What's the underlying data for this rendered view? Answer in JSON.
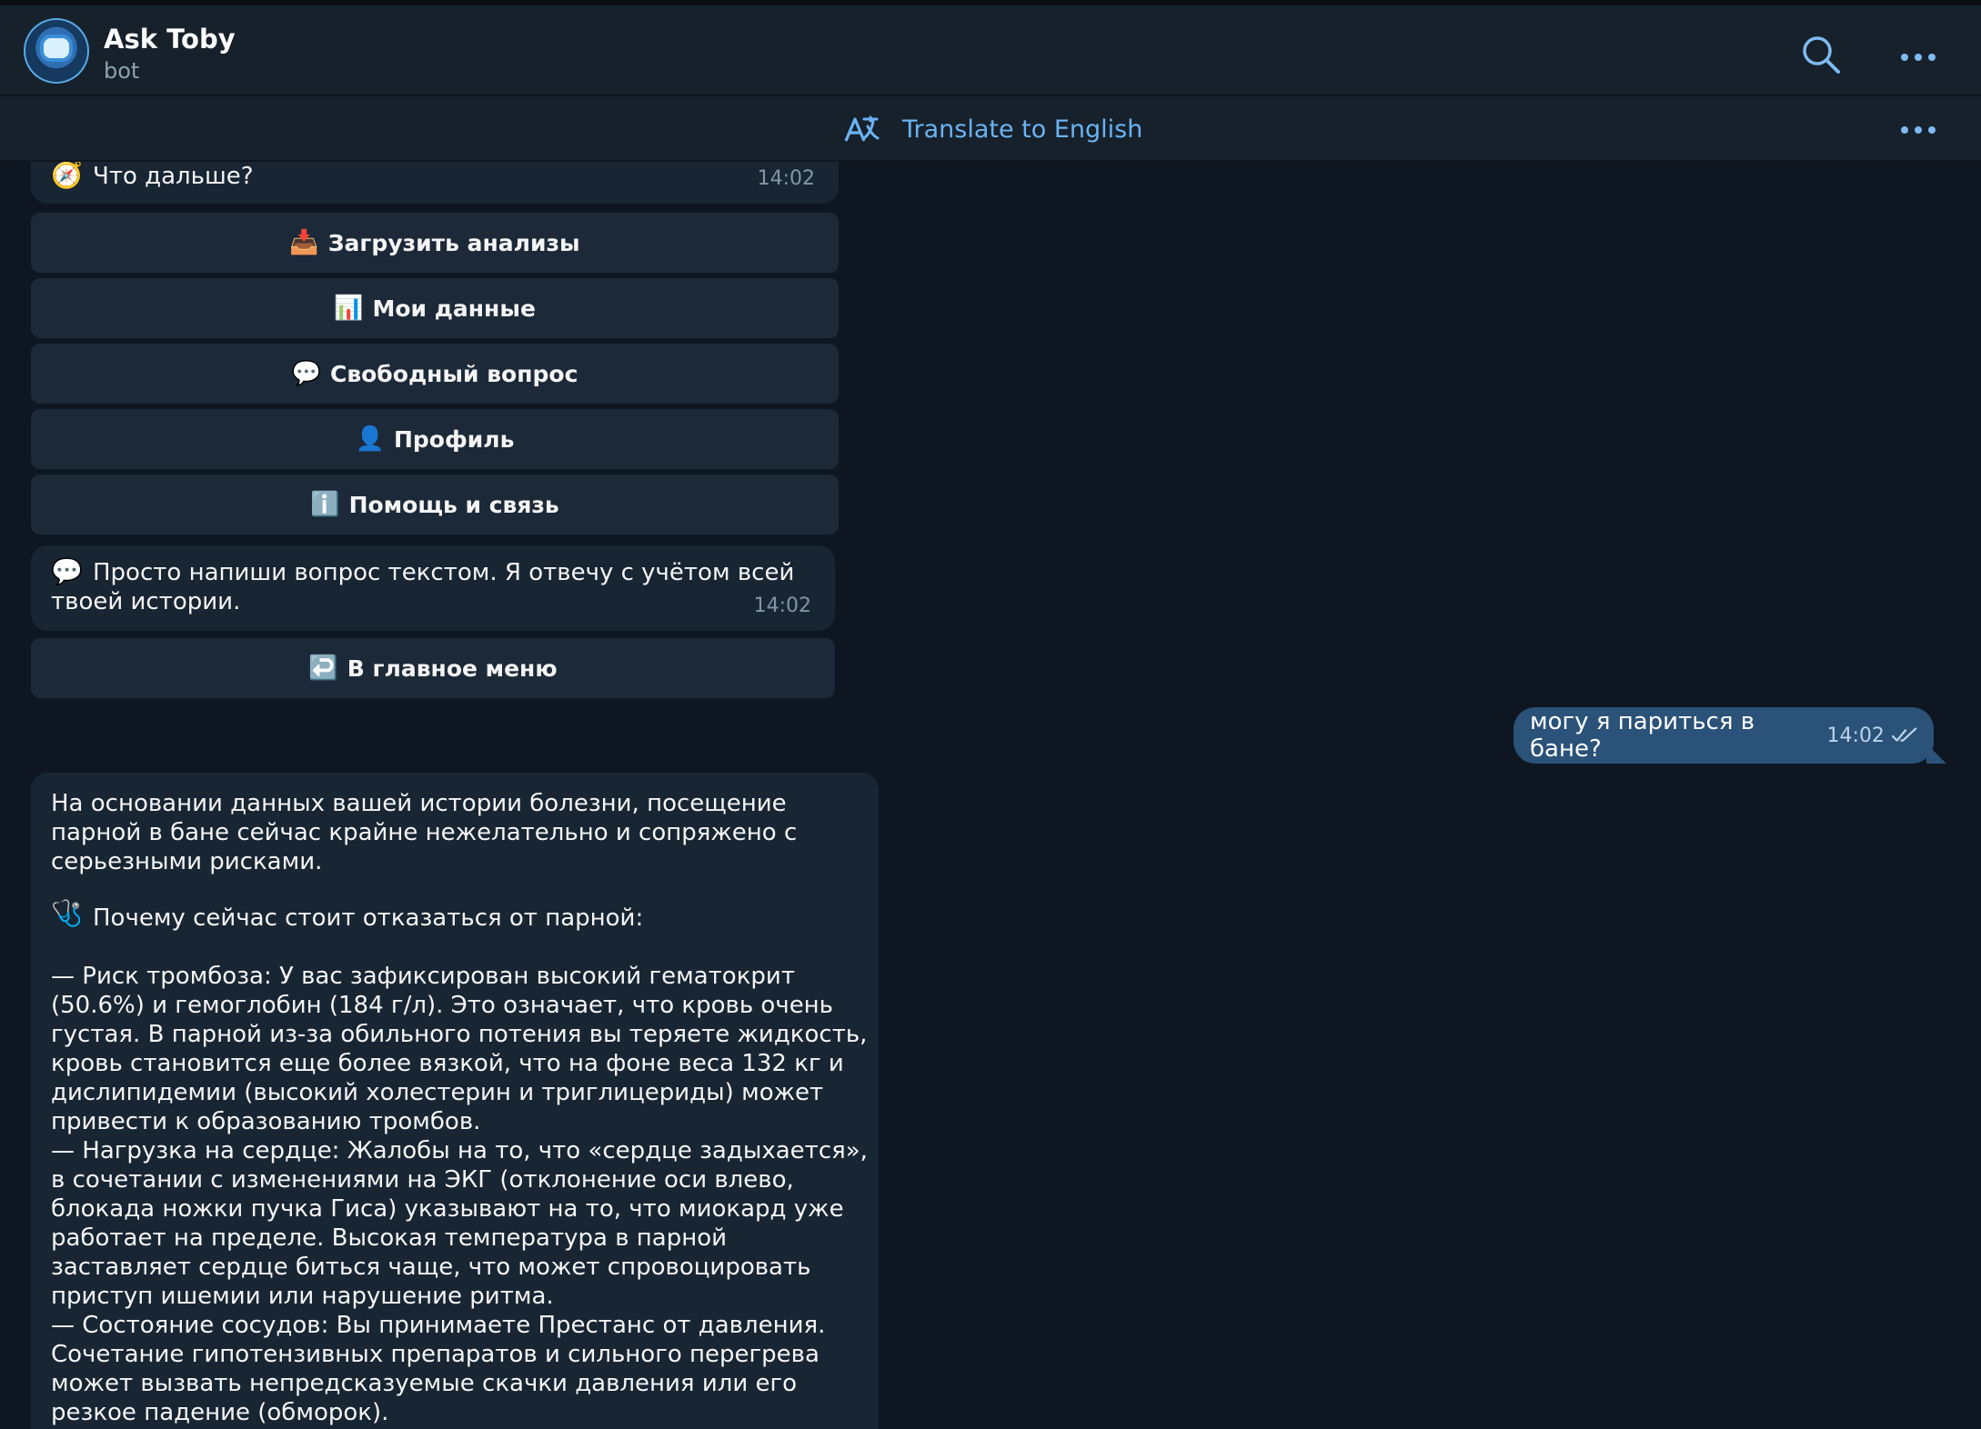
{
  "header": {
    "title": "Ask Toby",
    "subtitle": "bot"
  },
  "translate": {
    "label": "Translate to English"
  },
  "messages": {
    "next": {
      "text": "Что дальше?",
      "time": "14:02",
      "icon": "compass-icon"
    },
    "buttons": [
      {
        "label": "Загрузить анализы",
        "icon": "upload-icon"
      },
      {
        "label": "Мои данные",
        "icon": "chart-icon"
      },
      {
        "label": "Свободный вопрос",
        "icon": "speech-bubble-icon"
      },
      {
        "label": "Профиль",
        "icon": "profile-icon"
      },
      {
        "label": "Помощь и связь",
        "icon": "info-icon"
      }
    ],
    "prompt": {
      "text": "Просто напиши вопрос текстом. Я отвечу с учётом всей твоей истории.",
      "time": "14:02",
      "icon": "speech-bubble-icon"
    },
    "menu_button": {
      "label": "В главное меню",
      "icon": "return-icon"
    },
    "outgoing": {
      "text": "могу я париться в бане?",
      "time": "14:02",
      "status_icon": "double-check-icon"
    },
    "answer": {
      "intro": "На основании данных вашей истории болезни, посещение парной в бане сейчас крайне нежелательно и сопряжено с серьезными рисками.",
      "why_title": "Почему сейчас стоит отказаться от парной:",
      "why_icon": "stethoscope-icon",
      "points": "— Риск тромбоза: У вас зафиксирован высокий гематокрит (50.6%) и гемоглобин (184 г/л). Это означает, что кровь очень густая. В парной из-за обильного потения вы теряете жидкость, кровь становится еще более вязкой, что на фоне веса 132 кг и дислипидемии (высокий холестерин и триглицериды) может привести к образованию тромбов.\n— Нагрузка на сердце: Жалобы на то, что «сердце задыхается», в сочетании с изменениями на ЭКГ (отклонение оси влево, блокада ножки пучка Гиса) указывают на то, что миокард уже работает на пределе. Высокая температура в парной заставляет сердце биться чаще, что может спровоцировать приступ ишемии или нарушение ритма.\n— Состояние сосудов: Вы принимаете Престанс от давления. Сочетание гипотензивных препаратов и сильного перегрева может вызвать непредсказуемые скачки давления или его резкое падение (обморок)."
    }
  }
}
